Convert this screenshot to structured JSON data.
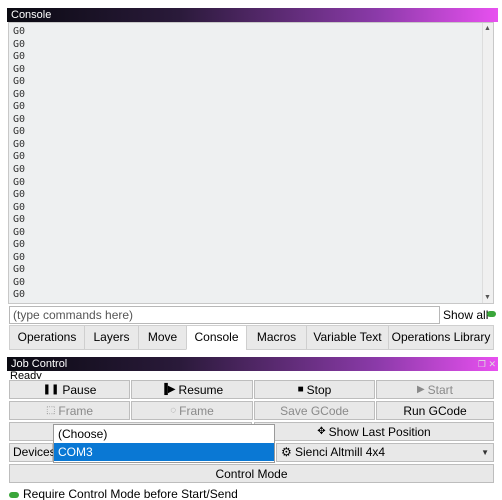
{
  "console_panel": {
    "title": "Console",
    "lines": [
      "G0",
      "G0",
      "G0",
      "G0",
      "G0",
      "G0",
      "G0",
      "G0",
      "G0",
      "G0",
      "G0",
      "G0",
      "G0",
      "G0",
      "G0",
      "G0",
      "G0",
      "G0",
      "G0",
      "G0",
      "G0",
      "G0"
    ],
    "command_placeholder": "(type commands here)",
    "show_all_label": "Show all"
  },
  "tabs": [
    {
      "label": "Operations"
    },
    {
      "label": "Layers"
    },
    {
      "label": "Move"
    },
    {
      "label": "Console",
      "active": true
    },
    {
      "label": "Macros"
    },
    {
      "label": "Variable Text"
    },
    {
      "label": "Operations Library"
    }
  ],
  "job_control": {
    "title": "Job Control",
    "status": "Ready",
    "buttons": {
      "pause": "Pause",
      "resume": "Resume",
      "stop": "Stop",
      "start": "Start",
      "frame_rect": "Frame",
      "frame_circle": "Frame",
      "save_gcode": "Save GCode",
      "run_gcode": "Run GCode",
      "show_last_position": "Show Last Position",
      "control_mode": "Control Mode"
    },
    "devices_label": "Devices",
    "port_options": [
      "(Choose)",
      "COM3"
    ],
    "selected_port": "COM3",
    "device_name": "Sienci Altmill 4x4",
    "require_control_label": "Require Control Mode before Start/Send"
  },
  "colors": {
    "accent_selected": "#0a78d4",
    "toggle_green": "#3aa63a"
  }
}
